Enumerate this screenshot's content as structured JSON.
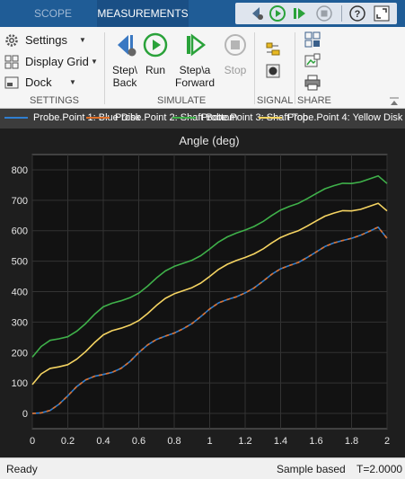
{
  "tabs": {
    "scope": "SCOPE",
    "measurements": "MEASUREMENTS"
  },
  "ribbon": {
    "settings_group": {
      "label": "SETTINGS",
      "settings": "Settings",
      "display_grid": "Display Grid",
      "dock": "Dock"
    },
    "simulate_group": {
      "label": "SIMULATE",
      "step_back": [
        "Step\\",
        "Back"
      ],
      "run": "Run",
      "step_forward": [
        "Step\\a",
        "Forward"
      ],
      "stop": "Stop"
    },
    "signal_group": {
      "label": "SIGNAL"
    },
    "share_group": {
      "label": "SHARE"
    }
  },
  "legend": [
    {
      "label": "Probe.Point 1: Blue Disk",
      "color": "#2f7fd1"
    },
    {
      "label": "Probe.Point 2: Shaft Bottom",
      "color": "#e0702a"
    },
    {
      "label": "Probe.Point 3: Shaft Top",
      "color": "#3fb14a"
    },
    {
      "label": "Probe.Point 4: Yellow Disk",
      "color": "#f5d462"
    }
  ],
  "chart_data": {
    "type": "line",
    "title": "Angle (deg)",
    "xlabel": "",
    "ylabel": "",
    "xlim": [
      0,
      2
    ],
    "ylim": [
      -50,
      850
    ],
    "x_ticks": [
      "0",
      "0.2",
      "0.4",
      "0.6",
      "0.8",
      "1",
      "1.2",
      "1.4",
      "1.6",
      "1.8",
      "2"
    ],
    "y_ticks": [
      "0",
      "100",
      "200",
      "300",
      "400",
      "500",
      "600",
      "700",
      "800"
    ],
    "grid": true,
    "x": [
      0,
      0.05,
      0.1,
      0.15,
      0.2,
      0.25,
      0.3,
      0.35,
      0.4,
      0.45,
      0.5,
      0.55,
      0.6,
      0.65,
      0.7,
      0.75,
      0.8,
      0.85,
      0.9,
      0.95,
      1.0,
      1.05,
      1.1,
      1.15,
      1.2,
      1.25,
      1.3,
      1.35,
      1.4,
      1.45,
      1.5,
      1.55,
      1.6,
      1.65,
      1.7,
      1.75,
      1.8,
      1.85,
      1.9,
      1.95,
      2.0
    ],
    "series": [
      {
        "color": "#2f7fd1",
        "values": [
          0,
          2,
          10,
          30,
          58,
          88,
          110,
          122,
          128,
          135,
          148,
          170,
          200,
          225,
          243,
          254,
          264,
          278,
          295,
          318,
          343,
          363,
          374,
          383,
          396,
          412,
          434,
          457,
          475,
          486,
          496,
          512,
          530,
          548,
          560,
          568,
          575,
          585,
          598,
          612,
          575
        ]
      },
      {
        "color": "#e0702a",
        "values": [
          0,
          2,
          10,
          30,
          58,
          88,
          110,
          122,
          128,
          135,
          148,
          170,
          200,
          225,
          243,
          254,
          264,
          278,
          295,
          318,
          343,
          363,
          374,
          383,
          396,
          412,
          434,
          457,
          475,
          486,
          496,
          512,
          530,
          548,
          560,
          568,
          575,
          585,
          598,
          612,
          575
        ]
      },
      {
        "color": "#3fb14a",
        "values": [
          185,
          220,
          240,
          245,
          252,
          270,
          295,
          325,
          350,
          362,
          370,
          380,
          395,
          418,
          445,
          468,
          483,
          493,
          503,
          518,
          540,
          563,
          580,
          592,
          602,
          614,
          630,
          650,
          668,
          680,
          690,
          705,
          722,
          738,
          748,
          756,
          755,
          760,
          770,
          780,
          755
        ]
      },
      {
        "color": "#f5d462",
        "values": [
          95,
          130,
          148,
          153,
          160,
          178,
          203,
          232,
          258,
          272,
          280,
          290,
          305,
          328,
          355,
          378,
          393,
          403,
          413,
          428,
          450,
          473,
          490,
          502,
          512,
          524,
          540,
          560,
          578,
          590,
          600,
          615,
          632,
          648,
          658,
          666,
          665,
          670,
          680,
          690,
          665
        ]
      }
    ]
  },
  "status": {
    "left": "Ready",
    "mode": "Sample based",
    "time": "T=2.0000"
  }
}
